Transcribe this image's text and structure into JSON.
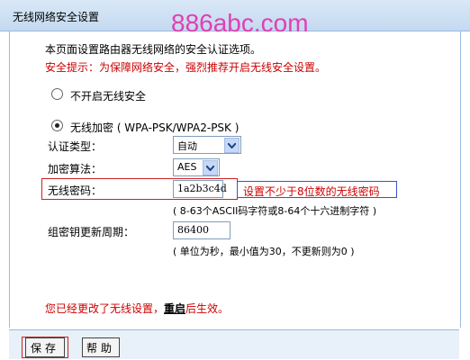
{
  "window": {
    "title": "无线网络安全设置",
    "watermark": "886abc.com"
  },
  "intro": {
    "description": "本页面设置路由器无线网络的安全认证选项。",
    "warning": "安全提示：为保障网络安全，强烈推荐开启无线安全设置。"
  },
  "security_options": {
    "none_label": "不开启无线安全",
    "wpa_label": "无线加密 ( WPA-PSK/WPA2-PSK )",
    "selected": "wpa"
  },
  "fields": {
    "auth_type_label": "认证类型：",
    "auth_type_value": "自动",
    "encryption_label": "加密算法：",
    "encryption_value": "AES",
    "password_label": "无线密码：",
    "password_value": "1a2b3c4d",
    "password_annotation": "设置不少于8位数的无线密码",
    "password_hint": "( 8-63个ASCII码字符或8-64个十六进制字符 )",
    "group_key_label": "组密钥更新周期：",
    "group_key_value": "86400",
    "group_key_hint": "( 单位为秒，最小值为30，不更新则为0 )"
  },
  "status": {
    "changed_prefix": "您已经更改了无线设置，",
    "reboot_link": "重启",
    "changed_suffix": "后生效。"
  },
  "buttons": {
    "save": "保存",
    "help": "帮助"
  },
  "colors": {
    "warning": "#cc0000",
    "watermark": "#e23fb3",
    "title_bar": "#c4d9f0"
  }
}
